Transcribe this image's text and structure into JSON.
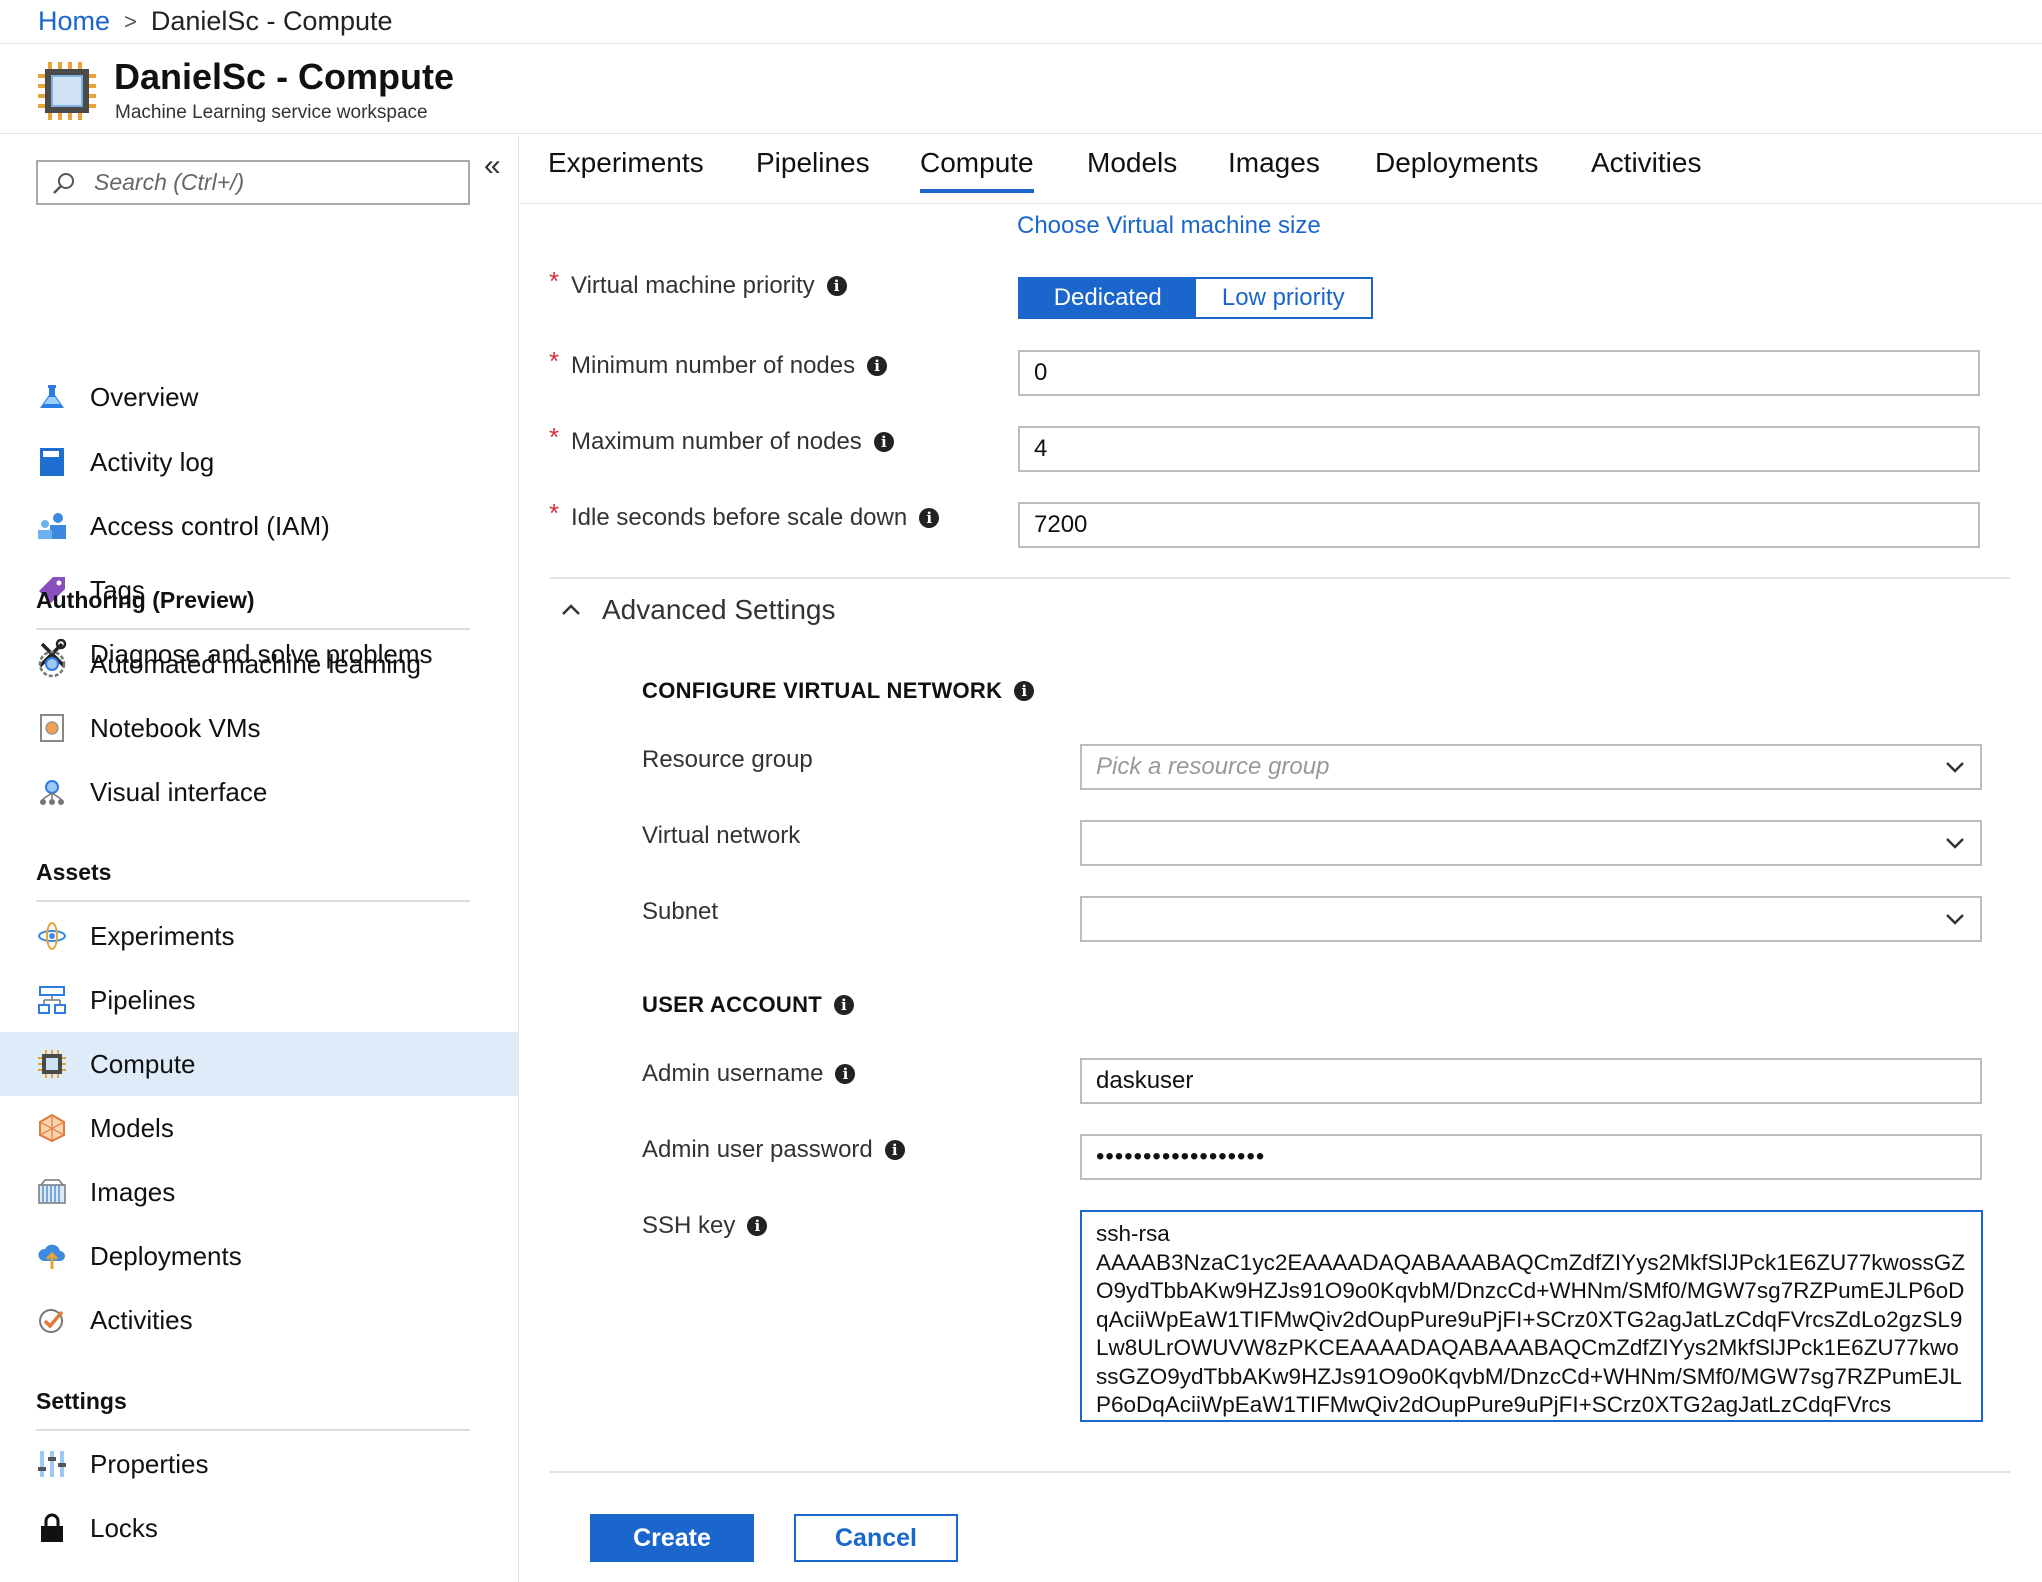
{
  "breadcrumb": {
    "home": "Home",
    "separator": ">",
    "current": "DanielSc - Compute"
  },
  "header": {
    "title": "DanielSc - Compute",
    "subtitle": "Machine Learning service workspace",
    "icon": "compute-chip-icon"
  },
  "sidebar": {
    "search_placeholder": "Search (Ctrl+/)",
    "collapse_glyph": "«",
    "items_top": [
      {
        "label": "Overview",
        "icon": "flask-icon"
      },
      {
        "label": "Activity log",
        "icon": "log-book-icon"
      },
      {
        "label": "Access control (IAM)",
        "icon": "users-icon"
      },
      {
        "label": "Tags",
        "icon": "tag-icon"
      },
      {
        "label": "Diagnose and solve problems",
        "icon": "wrench-icon"
      }
    ],
    "section_authoring": "Authoring (Preview)",
    "items_authoring": [
      {
        "label": "Automated machine learning",
        "icon": "automl-icon"
      },
      {
        "label": "Notebook VMs",
        "icon": "notebook-icon"
      },
      {
        "label": "Visual interface",
        "icon": "visual-interface-icon"
      }
    ],
    "section_assets": "Assets",
    "items_assets": [
      {
        "label": "Experiments",
        "icon": "experiments-icon"
      },
      {
        "label": "Pipelines",
        "icon": "pipelines-icon"
      },
      {
        "label": "Compute",
        "icon": "compute-icon",
        "active": true
      },
      {
        "label": "Models",
        "icon": "models-icon"
      },
      {
        "label": "Images",
        "icon": "images-icon"
      },
      {
        "label": "Deployments",
        "icon": "deployments-icon"
      },
      {
        "label": "Activities",
        "icon": "activities-icon"
      }
    ],
    "section_settings": "Settings",
    "items_settings": [
      {
        "label": "Properties",
        "icon": "properties-icon"
      },
      {
        "label": "Locks",
        "icon": "lock-icon"
      }
    ]
  },
  "tabs": [
    {
      "label": "Experiments"
    },
    {
      "label": "Pipelines"
    },
    {
      "label": "Compute",
      "active": true
    },
    {
      "label": "Models"
    },
    {
      "label": "Images"
    },
    {
      "label": "Deployments"
    },
    {
      "label": "Activities"
    }
  ],
  "form": {
    "choose_vm_link": "Choose Virtual machine size",
    "required_marker": "*",
    "priority": {
      "label": "Virtual machine priority",
      "options": [
        "Dedicated",
        "Low priority"
      ],
      "selected": "Dedicated"
    },
    "min_nodes": {
      "label": "Minimum number of nodes",
      "value": "0"
    },
    "max_nodes": {
      "label": "Maximum number of nodes",
      "value": "4"
    },
    "idle_seconds": {
      "label": "Idle seconds before scale down",
      "value": "7200"
    },
    "advanced_label": "Advanced Settings",
    "vnet_heading": "CONFIGURE VIRTUAL NETWORK",
    "resource_group": {
      "label": "Resource group",
      "placeholder": "Pick a resource group"
    },
    "virtual_network": {
      "label": "Virtual network",
      "value": ""
    },
    "subnet": {
      "label": "Subnet",
      "value": ""
    },
    "user_heading": "USER ACCOUNT",
    "admin_username": {
      "label": "Admin username",
      "value": "daskuser"
    },
    "admin_password": {
      "label": "Admin user password",
      "value": "••••••••••••••••••"
    },
    "ssh_key": {
      "label": "SSH key",
      "value": "ssh-rsa\nAAAAB3NzaC1yc2EAAAADAQABAAABAQCmZdfZIYys2MkfSlJPck1E6ZU77kwossGZO9ydTbbAKw9HZJs91O9o0KqvbM/DnzcCd+WHNm/SMf0/MGW7sg7RZPumEJLP6oDqAciiWpEaW1TIFMwQiv2dOupPure9uPjFI+SCrz0XTG2agJatLzCdqFVrcsZdLo2gzSL9Lw8ULrOWUVW8zPKCEAAAADAQABAAABAQCmZdfZIYys2MkfSlJPck1E6ZU77kwossGZO9ydTbbAKw9HZJs91O9o0KqvbM/DnzcCd+WHNm/SMf0/MGW7sg7RZPumEJLP6oDqAciiWpEaW1TIFMwQiv2dOupPure9uPjFI+SCrz0XTG2agJatLzCdqFVrcs"
    }
  },
  "buttons": {
    "create": "Create",
    "cancel": "Cancel"
  },
  "colors": {
    "accent": "#1a66cc",
    "active_nav_bg": "#deecf9",
    "required": "#d13438"
  }
}
